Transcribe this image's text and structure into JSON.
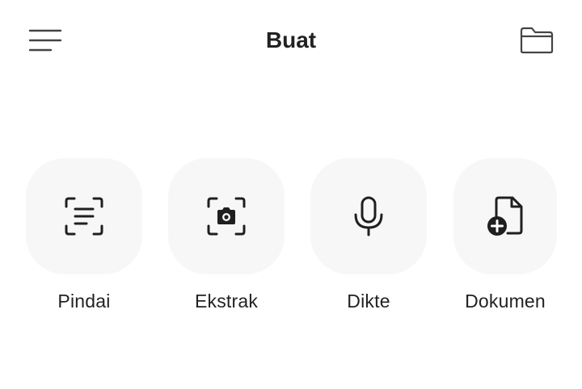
{
  "header": {
    "title": "Buat",
    "menu_icon": "menu-lines-icon",
    "folder_icon": "folder-icon"
  },
  "actions": [
    {
      "label": "Pindai",
      "icon": "scan-document-icon"
    },
    {
      "label": "Ekstrak",
      "icon": "camera-scan-icon"
    },
    {
      "label": "Dikte",
      "icon": "microphone-icon"
    },
    {
      "label": "Dokumen",
      "icon": "add-document-icon"
    }
  ],
  "colors": {
    "background": "#ffffff",
    "tile": "#f7f7f7",
    "text": "#222222",
    "icon": "#1f1f1f"
  }
}
